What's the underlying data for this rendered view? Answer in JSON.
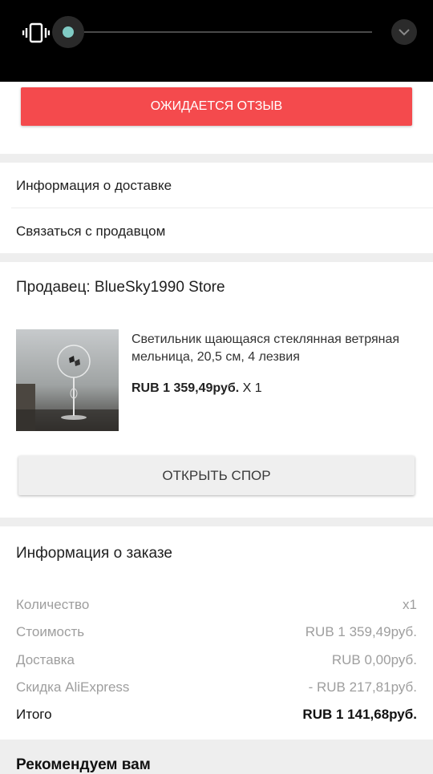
{
  "volume": {
    "icon": "vibrate-icon",
    "level": 0.0,
    "accent_color": "#80cbc4",
    "expand_icon": "chevron-down-icon"
  },
  "review_button": {
    "label": "ОЖИДАЕТСЯ ОТЗЫВ",
    "color": "#f44a4d"
  },
  "links": {
    "delivery_info": "Информация о доставке",
    "contact_seller": "Связаться с продавцом"
  },
  "seller": {
    "label": "Продавец: BlueSky1990 Store",
    "product": {
      "title": "Светильник щающаяся стеклянная ветряная мельница, 20,5 см, 4 лезвия",
      "price": "RUB 1 359,49руб.",
      "qty": " X 1"
    },
    "dispute_button": "ОТКРЫТЬ СПОР"
  },
  "order_info": {
    "title": "Информация о заказе",
    "rows": [
      {
        "label": "Количество",
        "value": "x1"
      },
      {
        "label": "Стоимость",
        "value": "RUB 1 359,49руб."
      },
      {
        "label": "Доставка",
        "value": "RUB 0,00руб."
      },
      {
        "label": "Скидка AliExpress",
        "value": "- RUB 217,81руб."
      }
    ],
    "total": {
      "label": "Итого",
      "value": "RUB 1 141,68руб."
    }
  },
  "recommend": {
    "title": "Рекомендуем вам"
  }
}
